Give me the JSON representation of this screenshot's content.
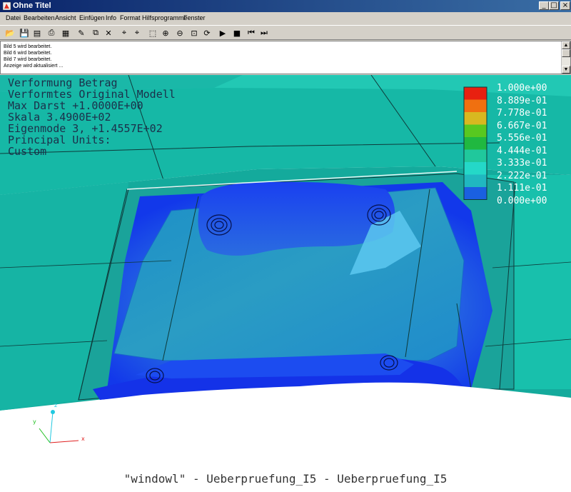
{
  "window": {
    "title": "Ohne Titel",
    "min_glyph": "_",
    "max_glyph": "□",
    "close_glyph": "×"
  },
  "menu": [
    "Datei",
    "Bearbeiten",
    "Ansicht",
    "Einfügen",
    "Info",
    "Format",
    "Hilfsprogramme",
    "Fenster"
  ],
  "toolbar": [
    {
      "icon": "open-folder-icon",
      "glyph": "📂"
    },
    {
      "icon": "save-icon",
      "glyph": "💾"
    },
    {
      "icon": "save-all-icon",
      "glyph": "▤"
    },
    {
      "icon": "print-icon",
      "glyph": "⎙"
    },
    {
      "icon": "page-setup-icon",
      "glyph": "▦"
    },
    {
      "icon": "edit-icon",
      "glyph": "✎"
    },
    {
      "icon": "copy-icon",
      "glyph": "⧉"
    },
    {
      "icon": "delete-icon",
      "glyph": "✕"
    },
    {
      "icon": "pick-icon",
      "glyph": "⌖"
    },
    {
      "icon": "unpick-icon",
      "glyph": "⌖"
    },
    {
      "icon": "select-region-icon",
      "glyph": "⬚"
    },
    {
      "icon": "zoom-in-icon",
      "glyph": "⊕"
    },
    {
      "icon": "zoom-out-icon",
      "glyph": "⊖"
    },
    {
      "icon": "zoom-window-icon",
      "glyph": "⊡"
    },
    {
      "icon": "spin-icon",
      "glyph": "⟳"
    },
    {
      "icon": "play-icon",
      "glyph": "▶"
    },
    {
      "icon": "stop-icon",
      "glyph": "■"
    },
    {
      "icon": "rewind-icon",
      "glyph": "⏮"
    },
    {
      "icon": "step-forward-icon",
      "glyph": "⏭"
    }
  ],
  "messages": [
    "Bild 5 wird bearbeitet.",
    "Bild 6 wird bearbeitet.",
    "Bild 7 wird bearbeitet.",
    "Anzeige wird aktualisiert ..."
  ],
  "plot_info": [
    "Verformung Betrag",
    "Verformtes Original Modell",
    "Max Darst  +1.0000E+00",
    "Skala  3.4900E+02",
    "Eigenmode  3, +1.4557E+02",
    "Principal Units:",
    "Custom"
  ],
  "legend": {
    "labels": [
      "1.000e+00",
      "8.889e-01",
      "7.778e-01",
      "6.667e-01",
      "5.556e-01",
      "4.444e-01",
      "3.333e-01",
      "2.222e-01",
      "1.111e-01",
      "0.000e+00"
    ],
    "colors": [
      "#e82010",
      "#f07010",
      "#d8b820",
      "#58c820",
      "#20b840",
      "#20c89c",
      "#24d8c8",
      "#20b8c0",
      "#1a60e0",
      "#0a1ef8"
    ]
  },
  "axes": {
    "x": "x",
    "y": "y",
    "z": "z"
  },
  "caption": "\"windowl\" - Ueberpruefung_I5 - Ueberpruefung_I5",
  "colors": {
    "model_teal": "#12b2a2",
    "model_blue": "#1430e8",
    "title_bar": "#0a246a"
  }
}
